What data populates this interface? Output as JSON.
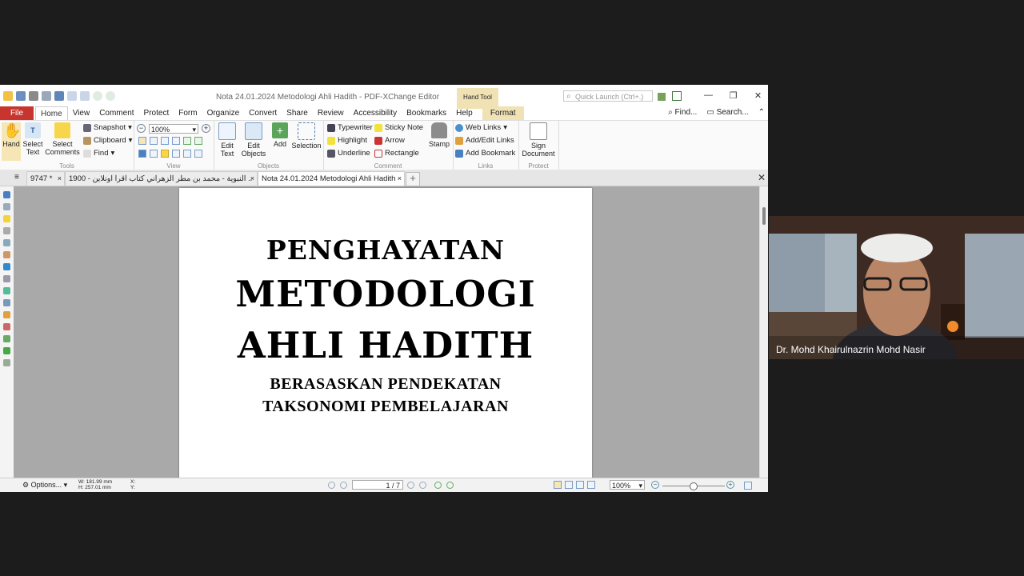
{
  "window": {
    "title": "Nota 24.01.2024 Metodologi Ahli Hadith - PDF-XChange Editor",
    "context_tool_label": "Hand Tool",
    "quick_launch_placeholder": "Quick Launch (Ctrl+.)"
  },
  "menu": {
    "file": "File",
    "tabs": [
      "Home",
      "View",
      "Comment",
      "Protect",
      "Form",
      "Organize",
      "Convert",
      "Share",
      "Review",
      "Accessibility",
      "Bookmarks",
      "Help"
    ],
    "context_tab": "Format",
    "find": "Find...",
    "search": "Search..."
  },
  "ribbon": {
    "tools": {
      "hand": "Hand",
      "select_text": "Select Text",
      "select_comments": "Select Comments",
      "group": "Tools"
    },
    "view": {
      "snapshot": "Snapshot",
      "clipboard": "Clipboard",
      "find": "Find",
      "zoom": "100%",
      "group": "View"
    },
    "objects": {
      "edit_text": "Edit Text",
      "edit_objects": "Edit Objects",
      "add": "Add",
      "selection": "Selection",
      "group": "Objects"
    },
    "comment": {
      "typewriter": "Typewriter",
      "highlight": "Highlight",
      "underline": "Underline",
      "sticky_note": "Sticky Note",
      "arrow": "Arrow",
      "rectangle": "Rectangle",
      "stamp": "Stamp",
      "group": "Comment"
    },
    "links": {
      "web_links": "Web Links",
      "add_edit_links": "Add/Edit Links",
      "add_bookmark": "Add Bookmark",
      "group": "Links"
    },
    "protect": {
      "sign_document": "Sign Document",
      "group": "Protect"
    }
  },
  "doc_tabs": [
    {
      "label": "9747 *"
    },
    {
      "label": "1900 - النبوية - محمد بن مطر الزهراني كتاب اقرا اونلاين .."
    },
    {
      "label": "Nota 24.01.2024 Metodologi Ahli Hadith"
    }
  ],
  "document": {
    "line1": "PENGHAYATAN",
    "line2": "METODOLOGI",
    "line3": "AHLI HADITH",
    "line4": "BERASASKAN PENDEKATAN",
    "line5": "TAKSONOMI PEMBELAJARAN"
  },
  "status": {
    "options": "Options...",
    "width": "W: 181.99 mm",
    "height": "H: 257.01 mm",
    "x": "X:",
    "y": "Y:",
    "page": "1 / 7",
    "zoom": "100%"
  },
  "video": {
    "participant_name": "Dr. Mohd Khairulnazrin Mohd Nasir"
  },
  "colors": {
    "file_tab": "#c8352e",
    "context_tab": "#f0e2b4",
    "canvas": "#a9a9a9"
  }
}
